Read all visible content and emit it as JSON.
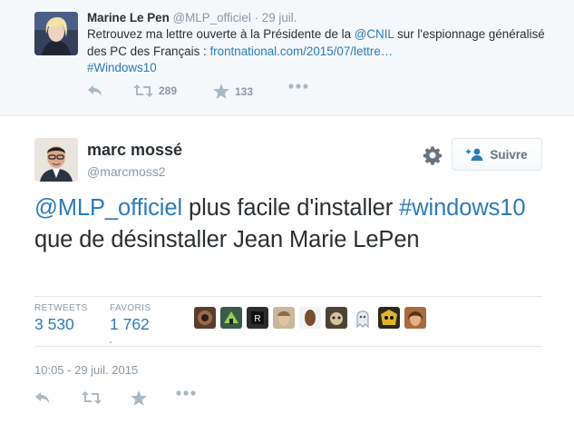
{
  "parent_tweet": {
    "name": "Marine Le Pen",
    "handle": "@MLP_officiel",
    "separator": "·",
    "time": "29 juil.",
    "text_before_mention": "Retrouvez ma lettre ouverte à la Présidente de la ",
    "mention": "@CNIL",
    "text_after_mention": " sur l'espionnage généralisé des PC des Français : ",
    "link": "frontnational.com/2015/07/lettre…",
    "hashtag": "#Windows10",
    "retweet_count": "289",
    "favorite_count": "133"
  },
  "main_tweet": {
    "name": "marc mossé",
    "handle": "@marcmoss2",
    "follow_label": "Suivre",
    "mention": "@MLP_officiel",
    "text_after_mention": " plus facile d'installer ",
    "hashtag": "#windows10",
    "text_after_hashtag": " que de désinstaller Jean Marie LePen",
    "retweets_label": "RETWEETS",
    "retweets_value": "3 530",
    "favorites_label": "FAVORIS",
    "favorites_value": "1 762",
    "timestamp": "10:05 - 29 juil. 2015"
  },
  "colors": {
    "link_blue": "#2b7bb9",
    "muted_gray": "#8899a6",
    "icon_gray": "#aab8c2",
    "text_dark": "#292f33",
    "parent_background": "#f5f8fa"
  },
  "icons": {
    "reply": "reply-icon",
    "retweet": "retweet-icon",
    "favorite": "star-icon",
    "more": "more-icon",
    "settings": "gear-icon",
    "follow": "add-user-icon"
  },
  "favoriters": [
    {
      "name": "favoriter-1"
    },
    {
      "name": "favoriter-2"
    },
    {
      "name": "favoriter-3"
    },
    {
      "name": "favoriter-4"
    },
    {
      "name": "favoriter-5"
    },
    {
      "name": "favoriter-6"
    },
    {
      "name": "favoriter-7"
    },
    {
      "name": "favoriter-8"
    },
    {
      "name": "favoriter-9"
    },
    {
      "name": "favoriter-10"
    }
  ]
}
